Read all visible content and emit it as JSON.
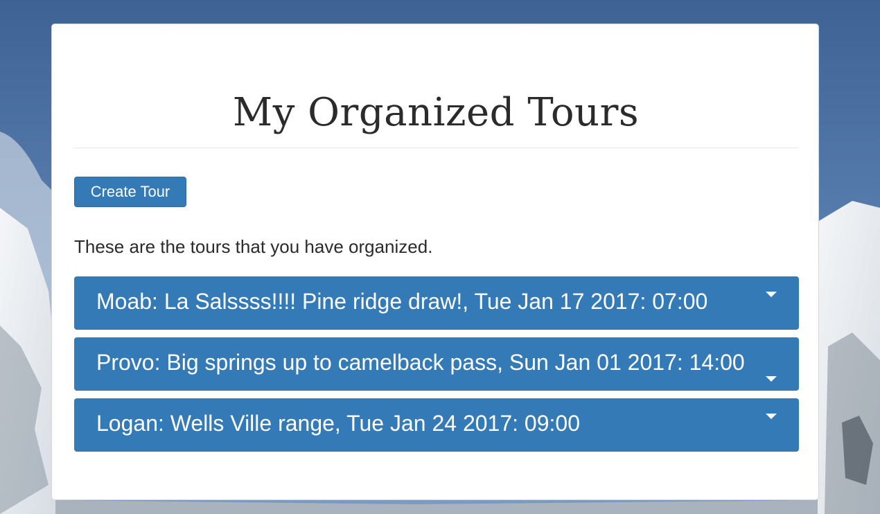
{
  "page": {
    "title": "My Organized Tours",
    "create_button_label": "Create Tour",
    "intro_text": "These are the tours that you have organized."
  },
  "tours": [
    {
      "label": "Moab: La Salssss!!!! Pine ridge draw!, Tue Jan 17 2017: 07:00"
    },
    {
      "label": "Provo: Big springs up to camelback pass, Sun Jan 01 2017: 14:00"
    },
    {
      "label": "Logan: Wells Ville range, Tue Jan 24 2017: 09:00"
    }
  ],
  "colors": {
    "accent": "#337ab7",
    "card_background": "#ffffff",
    "text": "#2b2b2b"
  },
  "icons": {
    "dropdown": "caret-down-icon"
  }
}
